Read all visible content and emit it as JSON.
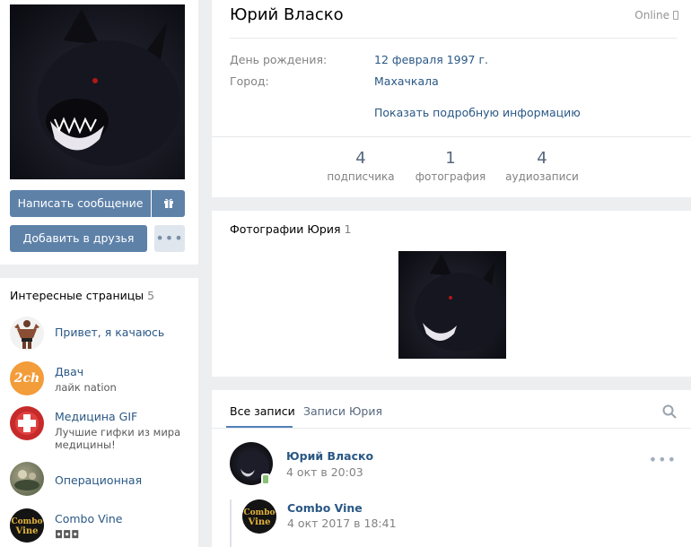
{
  "profile": {
    "name": "Юрий Власко",
    "online_status": "Online",
    "birthday_label": "День рождения:",
    "birthday_value": "12 февраля 1997 г.",
    "city_label": "Город:",
    "city_value": "Махачкала",
    "details_link": "Показать подробную информацию"
  },
  "actions": {
    "message_label": "Написать сообщение",
    "friend_label": "Добавить в друзья",
    "more_label": "•••"
  },
  "counters": [
    {
      "value": "4",
      "label": "подписчика"
    },
    {
      "value": "1",
      "label": "фотография"
    },
    {
      "value": "4",
      "label": "аудиозаписи"
    }
  ],
  "photos": {
    "title": "Фотографии Юрия",
    "count": "1"
  },
  "pages": {
    "title": "Интересные страницы",
    "count": "5",
    "items": [
      {
        "name": "Привет, я качаюсь",
        "sub": ""
      },
      {
        "name": "Двач",
        "sub": "лайк nation"
      },
      {
        "name": "Медицина GIF",
        "sub": "Лучшие гифки из мира медицины!"
      },
      {
        "name": "Операционная",
        "sub": ""
      },
      {
        "name": "Combo Vine",
        "sub": "◘◘◘"
      }
    ]
  },
  "wall": {
    "tabs": [
      "Все записи",
      "Записи Юрия"
    ],
    "post": {
      "author": "Юрий Власко",
      "time": "4 окт в 20:03",
      "more": "•••"
    },
    "repost": {
      "author": "Combo Vine",
      "time": "4 окт 2017 в 18:41"
    }
  },
  "colors": {
    "accent": "#5e81a8",
    "link": "#2a5885",
    "background": "#edeef0"
  }
}
